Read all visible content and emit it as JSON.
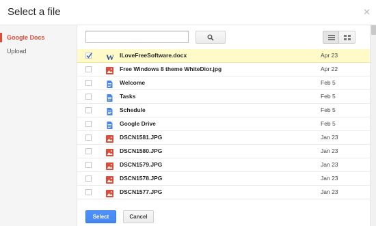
{
  "dialog": {
    "title": "Select a file",
    "close_icon": "close-icon"
  },
  "sidebar": {
    "items": [
      {
        "label": "Google Docs",
        "active": true
      },
      {
        "label": "Upload",
        "active": false
      }
    ]
  },
  "search": {
    "value": "",
    "placeholder": ""
  },
  "colors": {
    "accent": "#dd4b39",
    "primary_button": "#4d90fe",
    "selected_row": "#fffac8"
  },
  "files": [
    {
      "name": "ILoveFreeSoftware.docx",
      "date": "Apr 23",
      "icon": "word-doc-icon",
      "checked": true
    },
    {
      "name": "Free Windows 8 theme WhiteDior.jpg",
      "date": "Apr 22",
      "icon": "image-file-icon",
      "checked": false
    },
    {
      "name": "Welcome",
      "date": "Feb 5",
      "icon": "document-icon",
      "checked": false
    },
    {
      "name": "Tasks",
      "date": "Feb 5",
      "icon": "document-icon",
      "checked": false
    },
    {
      "name": "Schedule",
      "date": "Feb 5",
      "icon": "document-icon",
      "checked": false
    },
    {
      "name": "Google Drive",
      "date": "Feb 5",
      "icon": "document-icon",
      "checked": false
    },
    {
      "name": "DSCN1581.JPG",
      "date": "Jan 23",
      "icon": "image-file-icon",
      "checked": false
    },
    {
      "name": "DSCN1580.JPG",
      "date": "Jan 23",
      "icon": "image-file-icon",
      "checked": false
    },
    {
      "name": "DSCN1579.JPG",
      "date": "Jan 23",
      "icon": "image-file-icon",
      "checked": false
    },
    {
      "name": "DSCN1578.JPG",
      "date": "Jan 23",
      "icon": "image-file-icon",
      "checked": false
    },
    {
      "name": "DSCN1577.JPG",
      "date": "Jan 23",
      "icon": "image-file-icon",
      "checked": false
    }
  ],
  "footer": {
    "select_label": "Select",
    "cancel_label": "Cancel"
  }
}
